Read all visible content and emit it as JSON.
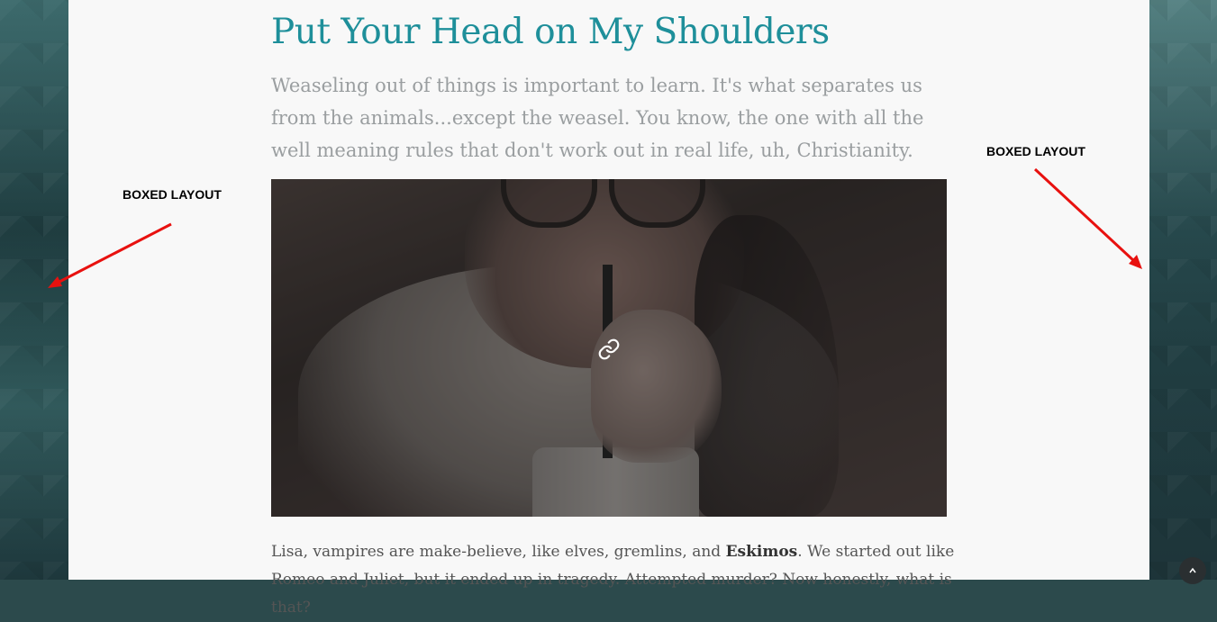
{
  "post": {
    "title": "Put Your Head on My Shoulders",
    "lead": "Weaseling out of things is important to learn. It's what separates us from the animals...except the weasel. You know, the one with all the well meaning rules that don't work out in real life, uh, Christianity.",
    "body_part1": "Lisa, vampires are make-believe, like elves, gremlins, and ",
    "body_bold": "Eskimos",
    "body_part2": ". We started out like Romeo and Juliet, but it ended up in tragedy. Attempted murder? Now honestly, what is that?"
  },
  "annotations": {
    "left_label": "BOXED LAYOUT",
    "right_label": "BOXED LAYOUT"
  },
  "icons": {
    "image_link": "link-icon",
    "scroll_top": "chevron-up-icon"
  },
  "colors": {
    "title": "#1e8f9a",
    "lead": "#9a9ea0",
    "box_background": "#f8f8f8",
    "arrow": "#e8110f"
  }
}
